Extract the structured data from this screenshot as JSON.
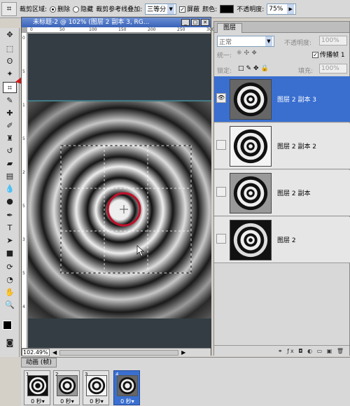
{
  "options_bar": {
    "crop_area_label": "裁剪区域:",
    "delete_label": "删除",
    "hide_label": "隐藏",
    "guide_overlay_label": "裁剪参考线叠加:",
    "guide_value": "三等分",
    "shield_label": "屏蔽",
    "color_label": "颜色:",
    "opacity_label": "不透明度:",
    "opacity_value": "75%"
  },
  "document": {
    "title": "未标题-2 @ 102% (图层 2 副本 3, RG...",
    "zoom": "102.49%",
    "ruler_top_ticks": [
      "0",
      "50",
      "100",
      "150",
      "200",
      "250",
      "300"
    ],
    "ruler_left_ticks": [
      "0",
      "5",
      "1",
      "5",
      "2",
      "5",
      "3",
      "5",
      "4"
    ]
  },
  "layers_panel": {
    "tab_label": "图层",
    "blend_mode": "正常",
    "opacity_label": "不透明度:",
    "opacity_value": "100%",
    "unify_label": "统一:",
    "propagate_label": "传播帧 1",
    "lock_label": "锁定:",
    "fill_label": "填充:",
    "fill_value": "100%",
    "layers": [
      {
        "name": "图层 2 副本 3",
        "selected": true
      },
      {
        "name": "图层 2 副本 2",
        "selected": false
      },
      {
        "name": "图层 2 副本",
        "selected": false
      },
      {
        "name": "图层 2",
        "selected": false
      }
    ]
  },
  "animation_panel": {
    "tab_label": "动画 (帧)",
    "frames": [
      {
        "number": "1",
        "delay": "0 秒▾"
      },
      {
        "number": "2",
        "delay": "0 秒▾"
      },
      {
        "number": "3",
        "delay": "0 秒▾"
      },
      {
        "number": "4",
        "delay": "0 秒▾"
      }
    ]
  },
  "colors": {
    "selection_blue": "#3a6fd0",
    "canvas_bg": "#333d43",
    "highlight_red": "#c0102a"
  }
}
